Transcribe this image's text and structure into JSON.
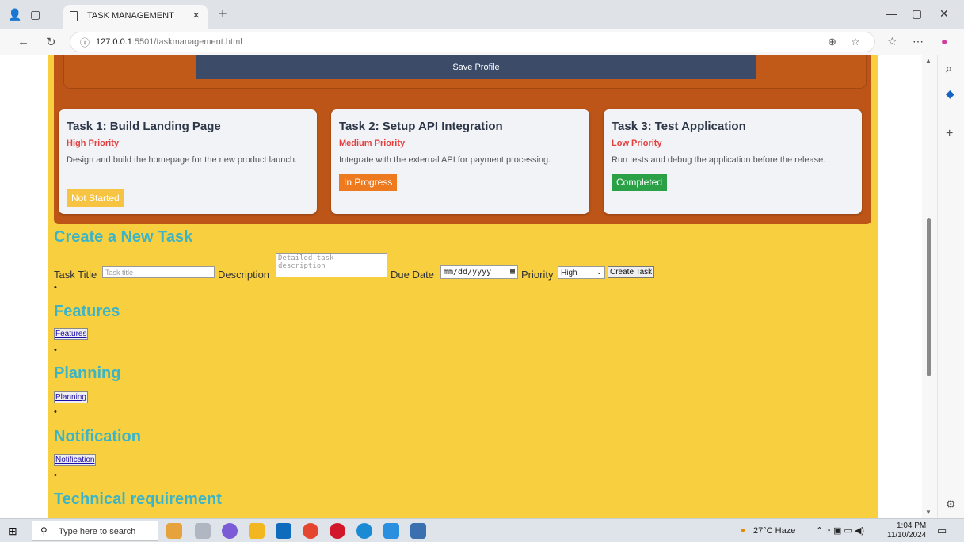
{
  "browser": {
    "tab_title": "TASK MANAGEMENT",
    "tab_close": "×",
    "new_tab": "+",
    "url_host": "127.0.0.1",
    "url_rest": ":5501/taskmanagement.html"
  },
  "profile": {
    "save_label": "Save Profile"
  },
  "tasks": [
    {
      "title": "Task 1: Build Landing Page",
      "priority": "High Priority",
      "description": "Design and build the homepage for the new product launch.",
      "status": "Not Started",
      "status_color": "#f6c343"
    },
    {
      "title": "Task 2: Setup API Integration",
      "priority": "Medium Priority",
      "description": "Integrate with the external API for payment processing.",
      "status": "In Progress",
      "status_color": "#ed7a1f"
    },
    {
      "title": "Task 3: Test Application",
      "priority": "Low Priority",
      "description": "Run tests and debug the application before the release.",
      "status": "Completed",
      "status_color": "#2aa146"
    }
  ],
  "create": {
    "heading": "Create a New Task",
    "title_label": "Task Title",
    "title_placeholder": "Task title",
    "description_label": "Description",
    "description_placeholder": "Detailed task description",
    "due_label": "Due Date",
    "due_value": "mm/dd/yyyy",
    "priority_label": "Priority",
    "priority_value": "High",
    "submit_label": "Create Task"
  },
  "sections": [
    {
      "heading": "Features",
      "link": "Features"
    },
    {
      "heading": "Planning",
      "link": "Planning"
    },
    {
      "heading": "Notification",
      "link": "Notification"
    },
    {
      "heading": "Technical requirement"
    }
  ],
  "bullet": "•",
  "taskbar": {
    "search_placeholder": "Type here to search",
    "weather": "27°C  Haze",
    "time": "1:04 PM",
    "date": "11/10/2024"
  }
}
